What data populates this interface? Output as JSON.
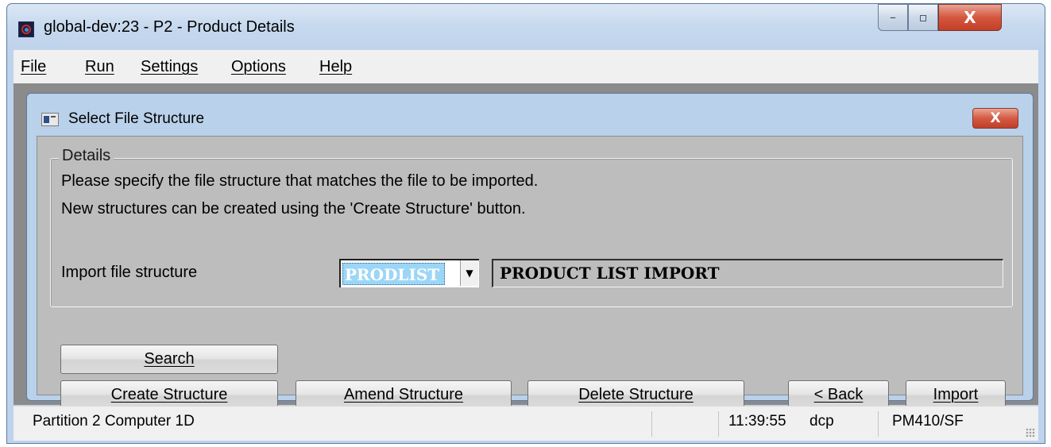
{
  "window": {
    "title": "global-dev:23 - P2 - Product Details",
    "controls": {
      "minimize": "–",
      "maximize": "▫",
      "close": "X"
    }
  },
  "menu": {
    "file": "File",
    "run": "Run",
    "settings": "Settings",
    "options": "Options",
    "help": "Help"
  },
  "dialog": {
    "title": "Select File Structure",
    "close": "X",
    "group_label": "Details",
    "line1": "Please specify the file structure that matches the file to be imported.",
    "line2": "New structures can be created using the 'Create Structure' button.",
    "import_label": "Import file structure",
    "structure_code": "PRODLIST",
    "structure_description": "PRODUCT LIST IMPORT",
    "dropdown_arrow": "▼",
    "buttons": {
      "search": "Search",
      "create": "Create Structure",
      "amend": "Amend Structure",
      "delete": "Delete Structure",
      "back": "< Back",
      "import": "Import"
    }
  },
  "status": {
    "left": "Partition 2 Computer 1D",
    "time": "11:39:55",
    "user": "dcp",
    "program": "PM410/SF"
  },
  "colors": {
    "selection": "#9cd6f7",
    "dialog_frame": "#b9d1ea",
    "close_red": "#d45a43"
  }
}
